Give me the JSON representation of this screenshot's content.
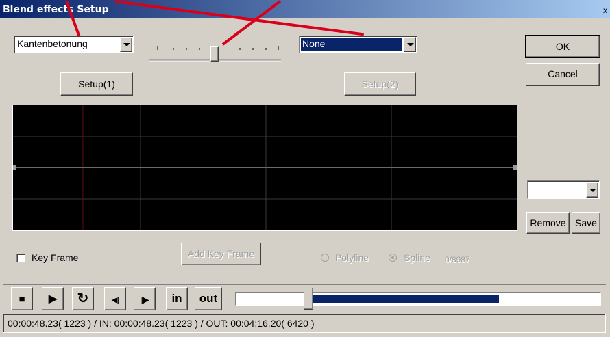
{
  "window": {
    "title": "Blend effects Setup",
    "close_label": "x"
  },
  "effect1": {
    "value": "Kantenbetonung"
  },
  "effect2": {
    "value": "None"
  },
  "blend_slider": {
    "level_fraction": 0.45
  },
  "buttons": {
    "ok": "OK",
    "cancel": "Cancel",
    "setup1": "Setup(1)",
    "setup2": "Setup(2)",
    "remove": "Remove",
    "save": "Save",
    "add_key_frame": "Add Key Frame"
  },
  "preset_combo": {
    "value": ""
  },
  "keyframe": {
    "checkbox_label": "Key Frame",
    "checked": false
  },
  "curve": {
    "polyline_label": "Polyline",
    "spline_label": "Spline",
    "selected": "Spline",
    "counter": "0/8987"
  },
  "transport": {
    "stop": "■",
    "play": "▶",
    "loop": "↻",
    "prev_frame": "◀||",
    "next_frame": "||▶",
    "in": "in",
    "out": "out"
  },
  "timeline": {
    "position_fraction": 0.2,
    "played_fraction": 0.72
  },
  "status": {
    "text": "00:00:48.23( 1223 ) / IN: 00:00:48.23( 1223 ) / OUT: 00:04:16.20( 6420 )"
  },
  "colors": {
    "title_bar": "#0a246a",
    "selection": "#0a246a",
    "annotation_arrow": "#d8001a",
    "graph_background": "#000000"
  }
}
